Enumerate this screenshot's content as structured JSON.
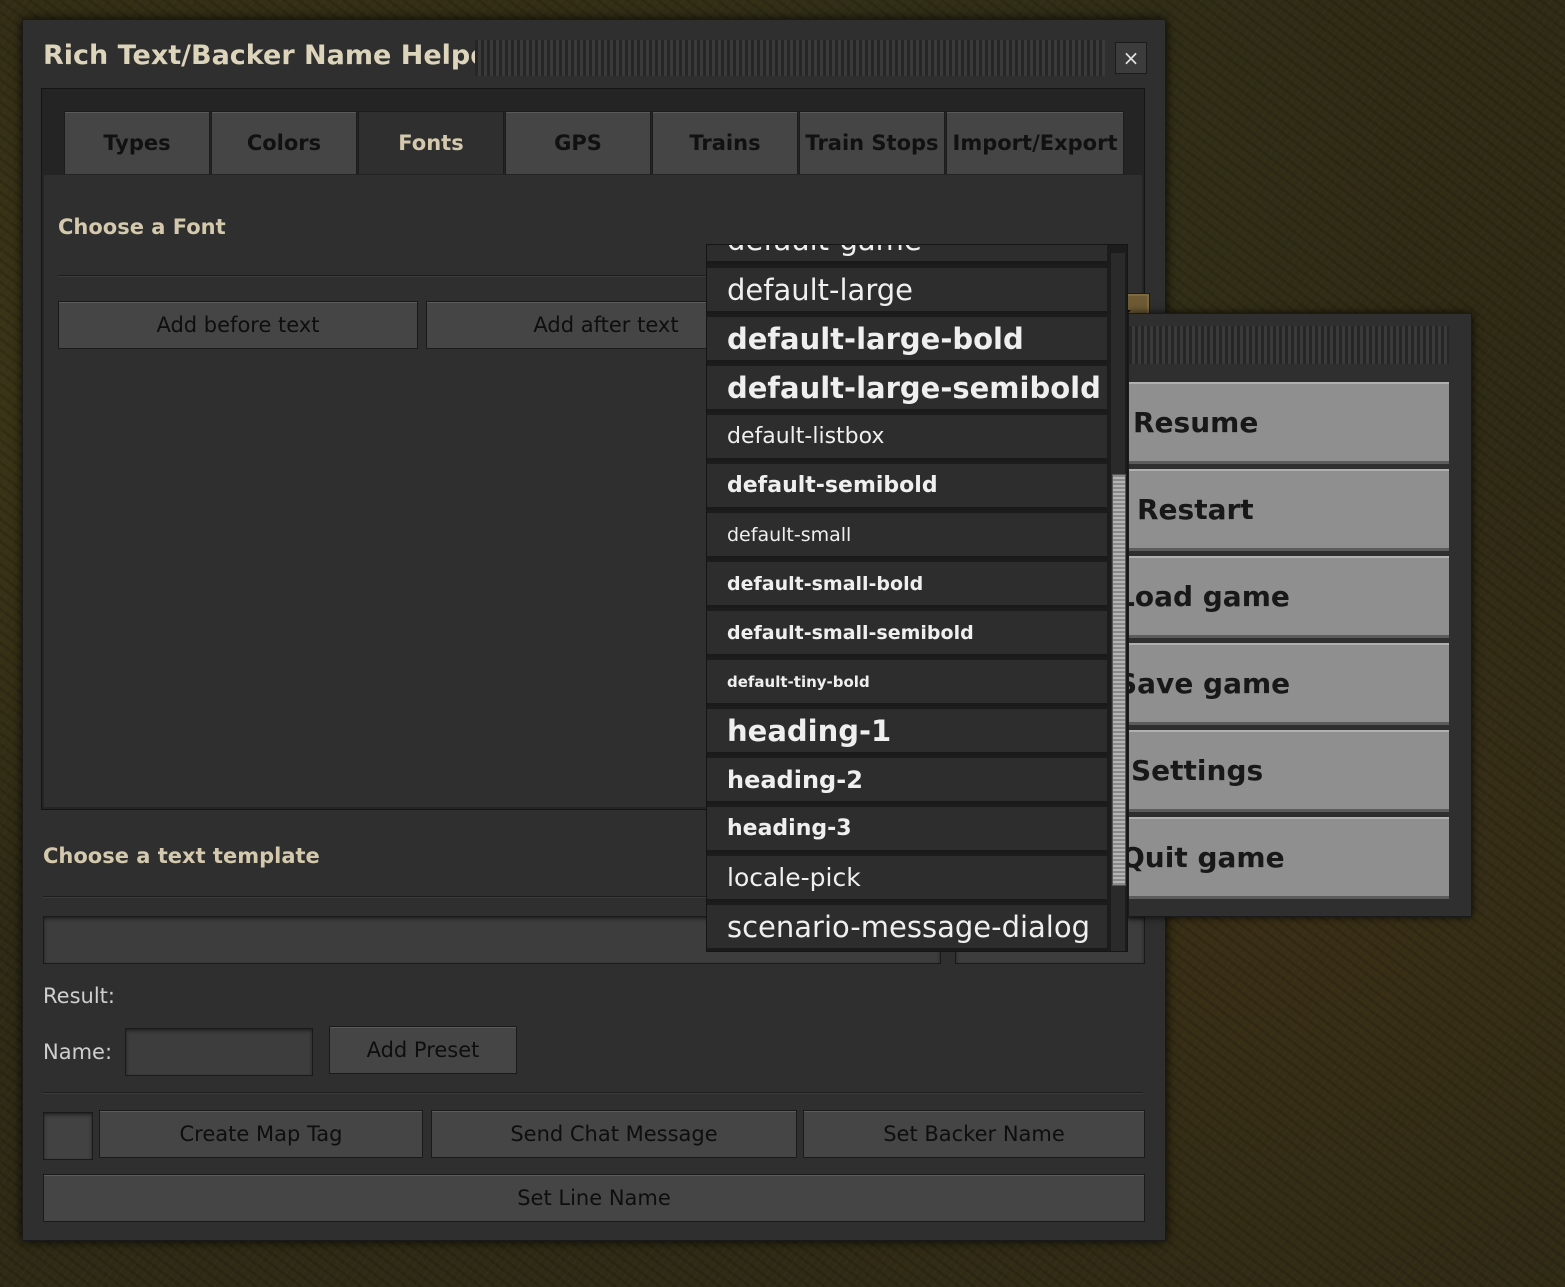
{
  "window": {
    "title": "Rich Text/Backer Name Helper",
    "close_glyph": "×"
  },
  "tabs": [
    {
      "label": "Types",
      "active": false
    },
    {
      "label": "Colors",
      "active": false
    },
    {
      "label": "Fonts",
      "active": true
    },
    {
      "label": "GPS",
      "active": false
    },
    {
      "label": "Trains",
      "active": false
    },
    {
      "label": "Train Stops",
      "active": false
    },
    {
      "label": "Import/Export",
      "active": false
    }
  ],
  "fonts_panel": {
    "choose_label": "Choose a Font",
    "selected_font": "",
    "add_before": "Add before text",
    "add_after": "Add after text"
  },
  "font_list": [
    {
      "label": "default-game"
    },
    {
      "label": "default-large"
    },
    {
      "label": "default-large-bold"
    },
    {
      "label": "default-large-semibold"
    },
    {
      "label": "default-listbox"
    },
    {
      "label": "default-semibold"
    },
    {
      "label": "default-small"
    },
    {
      "label": "default-small-bold"
    },
    {
      "label": "default-small-semibold"
    },
    {
      "label": "default-tiny-bold"
    },
    {
      "label": "heading-1"
    },
    {
      "label": "heading-2"
    },
    {
      "label": "heading-3"
    },
    {
      "label": "locale-pick"
    },
    {
      "label": "scenario-message-dialog"
    }
  ],
  "template": {
    "label": "Choose a text template",
    "value": ""
  },
  "result": {
    "label": "Result:"
  },
  "preset": {
    "name_label": "Name:",
    "name_value": "",
    "add_button": "Add Preset"
  },
  "actions": {
    "create_map_tag": "Create Map Tag",
    "send_chat": "Send Chat Message",
    "set_backer": "Set Backer Name",
    "set_line": "Set Line Name"
  },
  "game_menu": {
    "items": [
      "Resume",
      "Restart",
      "Load game",
      "Save game",
      "Settings",
      "Quit game"
    ]
  },
  "colors": {
    "accent": "#6e5a33",
    "panel": "#2f2f2f",
    "heading": "#d4c9ad"
  }
}
